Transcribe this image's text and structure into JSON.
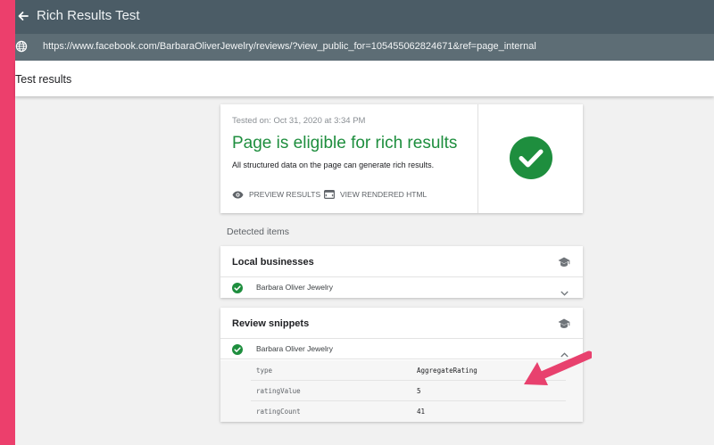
{
  "app": {
    "title": "Rich Results Test"
  },
  "url_bar": {
    "url": "https://www.facebook.com/BarbaraOliverJewelry/reviews/?view_public_for=105455062824671&ref=page_internal"
  },
  "header": {
    "title": "Test results"
  },
  "summary": {
    "tested_on": "Tested on: Oct 31, 2020 at 3:34 PM",
    "title": "Page is eligible for rich results",
    "subtitle": "All structured data on the page can generate rich results.",
    "preview_label": "PREVIEW RESULTS",
    "rendered_label": "VIEW RENDERED HTML",
    "status_color": "#1e8e3e"
  },
  "detected": {
    "label": "Detected items",
    "local_businesses": {
      "title": "Local businesses",
      "items": [
        {
          "name": "Barbara Oliver Jewelry"
        }
      ]
    },
    "review_snippets": {
      "title": "Review snippets",
      "items": [
        {
          "name": "Barbara Oliver Jewelry"
        }
      ],
      "properties": [
        {
          "key": "type",
          "value": "AggregateRating"
        },
        {
          "key": "ratingValue",
          "value": "5"
        },
        {
          "key": "ratingCount",
          "value": "41"
        }
      ]
    }
  },
  "icons": {
    "back": "arrow-back-icon",
    "globe": "globe-icon",
    "eye": "eye-icon",
    "code": "code-window-icon",
    "cap": "graduation-cap-icon",
    "check": "check-circle-icon",
    "expand": "chevron-down-icon",
    "collapse": "chevron-up-icon"
  },
  "colors": {
    "accent_pink": "#ec3f6c",
    "app_bar": "#4b5c66",
    "url_bar": "#5d6d75",
    "success_green": "#1e8e3e"
  }
}
